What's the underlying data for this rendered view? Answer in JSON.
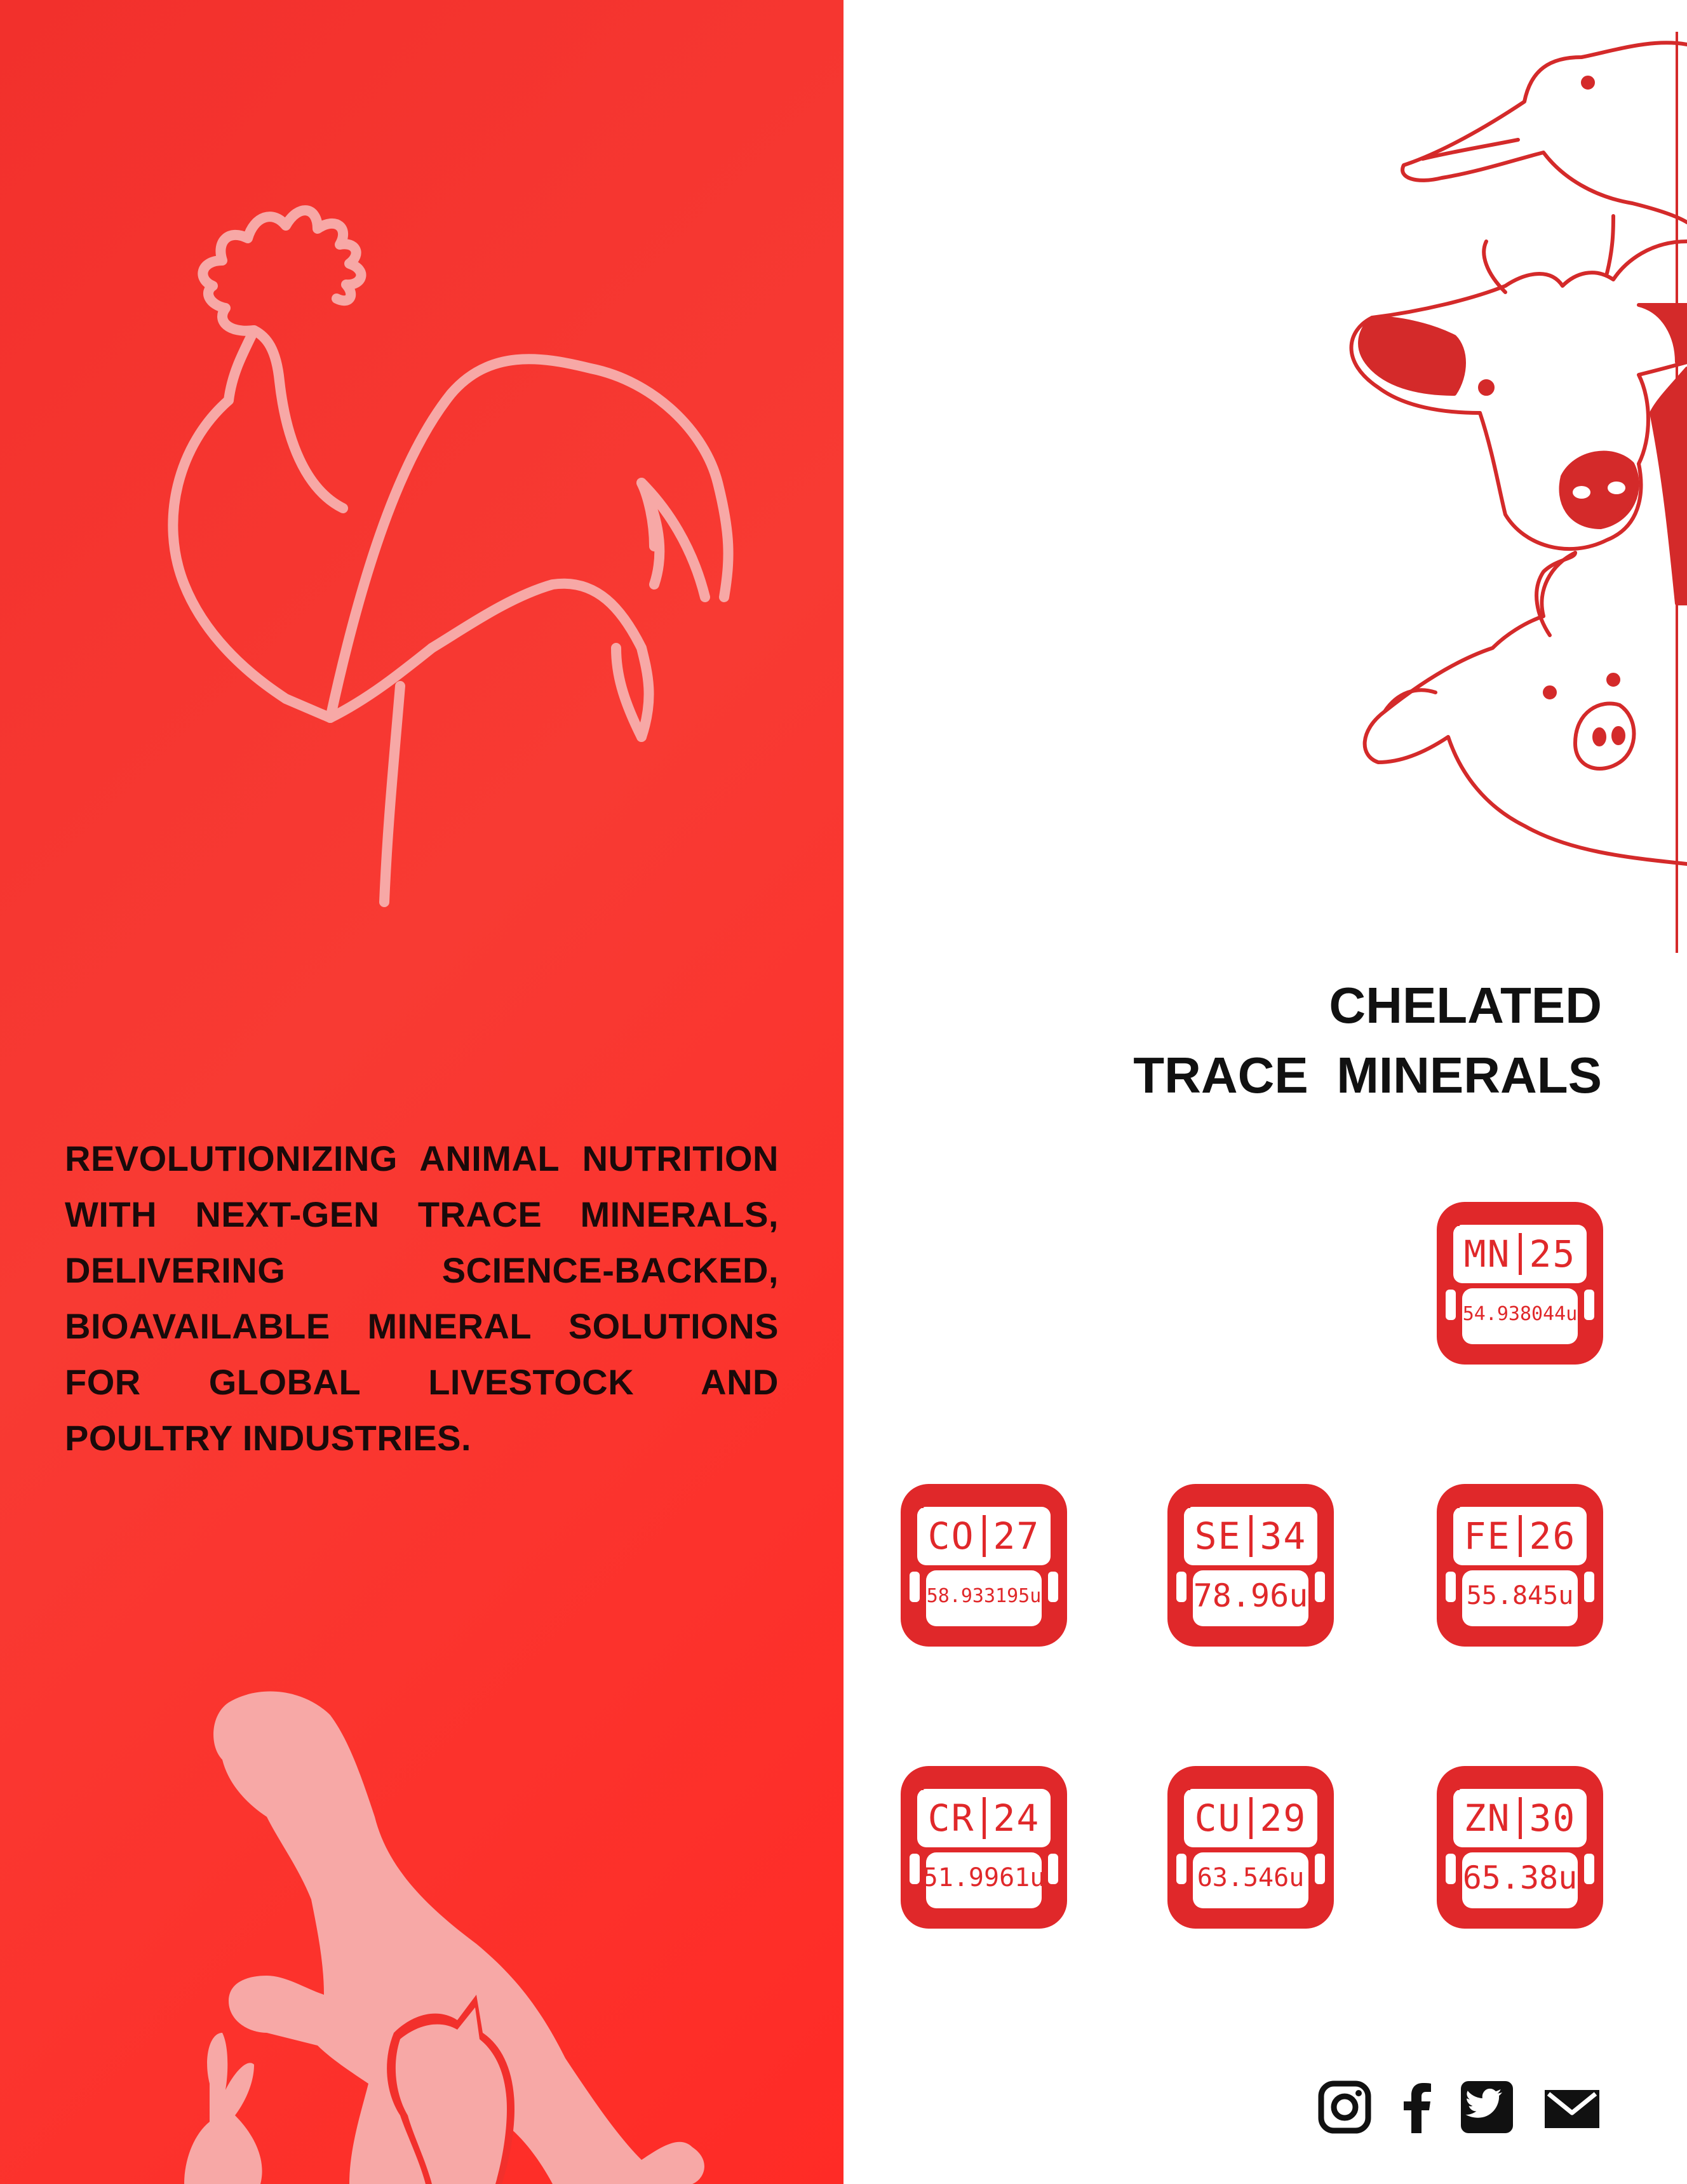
{
  "colors": {
    "brand_red": "#f2302c",
    "tile_red": "#e0282a",
    "illustration_pink": "#f7a8a6",
    "text_dark": "#111111"
  },
  "tagline": "REVOLUTIONIZING ANIMAL NUTRITION WITH NEXT-GEN TRACE MINERALS, DELIVERING SCIENCE-BACKED, BIOAVAILABLE MINERAL SOLUTIONS FOR GLOBAL LIVESTOCK AND POULTRY INDUSTRIES.",
  "title": {
    "line1": "CHELATED",
    "line2": "TRACE  MINERALS"
  },
  "minerals": [
    {
      "symbol": "MN",
      "number": "25",
      "mass": "54.938044u"
    },
    {
      "symbol": "CO",
      "number": "27",
      "mass": "58.933195u"
    },
    {
      "symbol": "SE",
      "number": "34",
      "mass": "78.96u"
    },
    {
      "symbol": "FE",
      "number": "26",
      "mass": "55.845u"
    },
    {
      "symbol": "CR",
      "number": "24",
      "mass": "51.9961u"
    },
    {
      "symbol": "CU",
      "number": "29",
      "mass": "63.546u"
    },
    {
      "symbol": "ZN",
      "number": "30",
      "mass": "65.38u"
    }
  ],
  "illustrations": [
    "rooster-line-art",
    "dog-cat-rabbit-silhouette",
    "duck-cow-pig-line-art"
  ],
  "social_icons": [
    "instagram-icon",
    "facebook-icon",
    "twitter-icon",
    "email-icon"
  ]
}
